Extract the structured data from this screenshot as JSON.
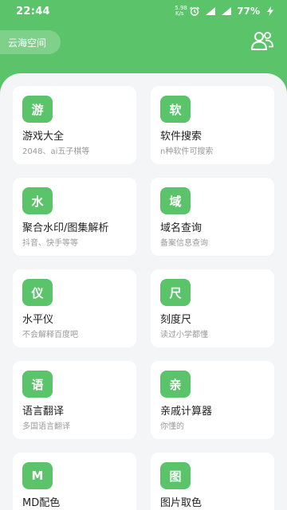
{
  "status_bar": {
    "time": "22:44",
    "net_speed_top": "5.98",
    "net_speed_bottom": "K/s",
    "battery": "77%"
  },
  "header": {
    "space_label": "云海空间"
  },
  "colors": {
    "accent": "#5bc46a",
    "background": "#f4f5f7",
    "card": "#ffffff"
  },
  "tools": [
    {
      "icon_char": "游",
      "title": "游戏大全",
      "subtitle": "2048、ai五子棋等"
    },
    {
      "icon_char": "软",
      "title": "软件搜索",
      "subtitle": "n种软件可搜索"
    },
    {
      "icon_char": "水",
      "title": "聚合水印/图集解析",
      "subtitle": "抖音、快手等等"
    },
    {
      "icon_char": "域",
      "title": "域名查询",
      "subtitle": "备案信息查询"
    },
    {
      "icon_char": "仪",
      "title": "水平仪",
      "subtitle": "不会解释百度吧"
    },
    {
      "icon_char": "尺",
      "title": "刻度尺",
      "subtitle": "读过小学都懂"
    },
    {
      "icon_char": "语",
      "title": "语言翻译",
      "subtitle": "多国语言翻译"
    },
    {
      "icon_char": "亲",
      "title": "亲戚计算器",
      "subtitle": "你懂的"
    },
    {
      "icon_char": "M",
      "title": "MD配色",
      "subtitle": ""
    },
    {
      "icon_char": "图",
      "title": "图片取色",
      "subtitle": ""
    }
  ]
}
